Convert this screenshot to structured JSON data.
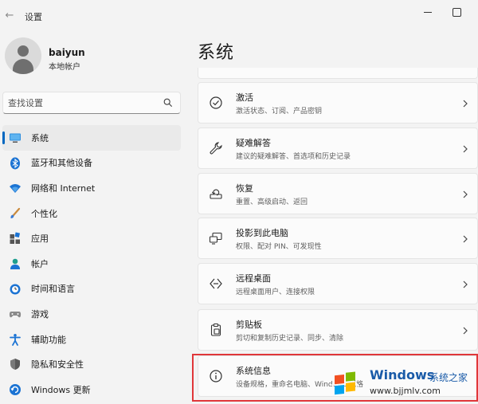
{
  "window": {
    "title": "设置"
  },
  "profile": {
    "name": "baiyun",
    "account_type": "本地帐户"
  },
  "search": {
    "placeholder": "查找设置"
  },
  "nav": {
    "items": [
      {
        "label": "系统",
        "icon": "monitor-icon",
        "active": true
      },
      {
        "label": "蓝牙和其他设备",
        "icon": "bluetooth-icon"
      },
      {
        "label": "网络和 Internet",
        "icon": "wifi-icon"
      },
      {
        "label": "个性化",
        "icon": "brush-icon"
      },
      {
        "label": "应用",
        "icon": "apps-icon"
      },
      {
        "label": "帐户",
        "icon": "person-icon"
      },
      {
        "label": "时间和语言",
        "icon": "globe-clock-icon"
      },
      {
        "label": "游戏",
        "icon": "gamepad-icon"
      },
      {
        "label": "辅助功能",
        "icon": "accessibility-icon"
      },
      {
        "label": "隐私和安全性",
        "icon": "shield-icon"
      },
      {
        "label": "Windows 更新",
        "icon": "windows-update-icon"
      }
    ]
  },
  "main": {
    "title": "系统",
    "cards": [
      {
        "title": "激活",
        "desc": "激活状态、订阅、产品密钥",
        "icon": "check-circle-icon"
      },
      {
        "title": "疑难解答",
        "desc": "建议的疑难解答、首选项和历史记录",
        "icon": "wrench-icon"
      },
      {
        "title": "恢复",
        "desc": "重置、高级启动、返回",
        "icon": "recovery-icon"
      },
      {
        "title": "投影到此电脑",
        "desc": "权限、配对 PIN、可发现性",
        "icon": "project-icon"
      },
      {
        "title": "远程桌面",
        "desc": "远程桌面用户、连接权限",
        "icon": "remote-desktop-icon"
      },
      {
        "title": "剪贴板",
        "desc": "剪切和复制历史记录、同步、清除",
        "icon": "clipboard-icon"
      },
      {
        "title": "系统信息",
        "desc": "设备规格，重命名电脑、Windows 规格",
        "icon": "info-icon"
      }
    ]
  },
  "watermark": {
    "brand": "Windows",
    "sub": "系统之家",
    "url": "www.bjjmlv.com"
  },
  "colors": {
    "accent": "#0067c0",
    "highlight": "#e0373a"
  }
}
